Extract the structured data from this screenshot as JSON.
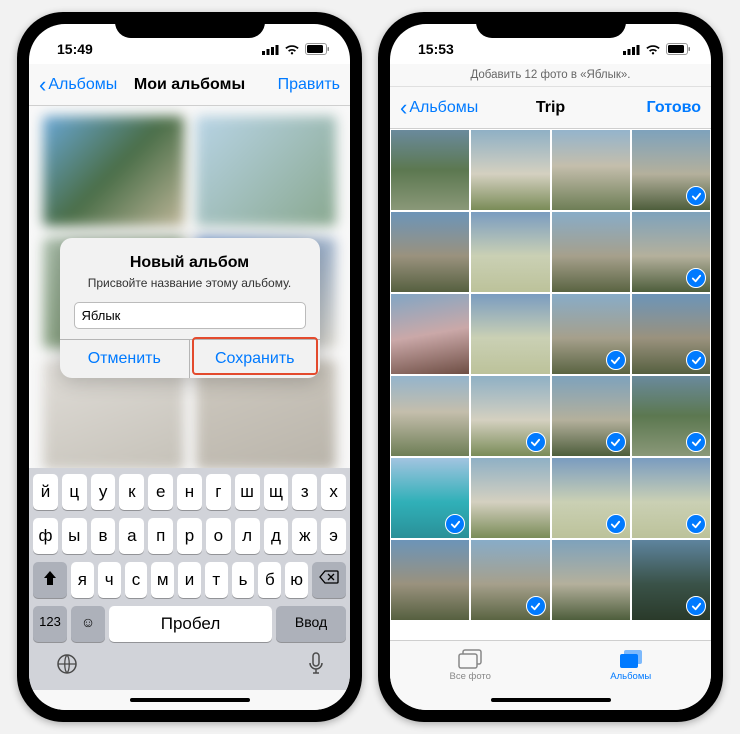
{
  "left": {
    "status": {
      "time": "15:49"
    },
    "nav": {
      "back": "Альбомы",
      "title": "Мои альбомы",
      "right": "Править"
    },
    "alert": {
      "title": "Новый альбом",
      "message": "Присвойте название этому альбому.",
      "input_value": "Яблык",
      "cancel": "Отменить",
      "save": "Сохранить"
    },
    "keyboard": {
      "row1": [
        "й",
        "ц",
        "у",
        "к",
        "е",
        "н",
        "г",
        "ш",
        "щ",
        "з",
        "х"
      ],
      "row2": [
        "ф",
        "ы",
        "в",
        "а",
        "п",
        "р",
        "о",
        "л",
        "д",
        "ж",
        "э"
      ],
      "row3": [
        "я",
        "ч",
        "с",
        "м",
        "и",
        "т",
        "ь",
        "б",
        "ю"
      ],
      "num": "123",
      "space": "Пробел",
      "enter": "Ввод"
    }
  },
  "right": {
    "status": {
      "time": "15:53"
    },
    "subheader": "Добавить 12 фото в «Яблык».",
    "nav": {
      "back": "Альбомы",
      "title": "Trip",
      "right": "Готово"
    },
    "photos": [
      {
        "cls": "pa",
        "selected": false
      },
      {
        "cls": "pb",
        "selected": false
      },
      {
        "cls": "pc",
        "selected": false
      },
      {
        "cls": "pd",
        "selected": true
      },
      {
        "cls": "pe",
        "selected": false
      },
      {
        "cls": "pg",
        "selected": false
      },
      {
        "cls": "ph",
        "selected": false
      },
      {
        "cls": "pd",
        "selected": true
      },
      {
        "cls": "pf",
        "selected": false
      },
      {
        "cls": "pg",
        "selected": false
      },
      {
        "cls": "ph",
        "selected": true
      },
      {
        "cls": "pe",
        "selected": true
      },
      {
        "cls": "pc",
        "selected": false
      },
      {
        "cls": "pb",
        "selected": true
      },
      {
        "cls": "pd",
        "selected": true
      },
      {
        "cls": "pa",
        "selected": true
      },
      {
        "cls": "pi",
        "selected": true
      },
      {
        "cls": "pb",
        "selected": false
      },
      {
        "cls": "pg",
        "selected": true
      },
      {
        "cls": "pg",
        "selected": true
      },
      {
        "cls": "pe",
        "selected": false
      },
      {
        "cls": "ph",
        "selected": true
      },
      {
        "cls": "pd",
        "selected": false
      },
      {
        "cls": "pj",
        "selected": true
      }
    ],
    "tabs": {
      "all": "Все фото",
      "albums": "Альбомы"
    }
  }
}
